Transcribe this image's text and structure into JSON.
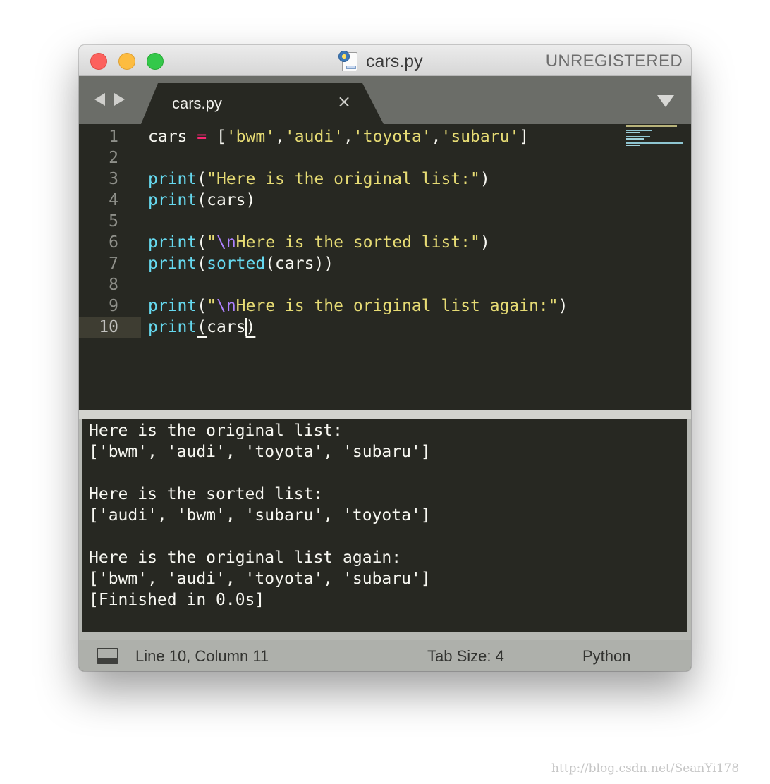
{
  "window": {
    "title": "cars.py",
    "license_label": "UNREGISTERED"
  },
  "icons": {
    "file": "python-file-icon",
    "nav_back": "chevron-left-icon",
    "nav_forward": "chevron-right-icon",
    "tab_close": "close-icon",
    "tab_menu": "dropdown-triangle-icon",
    "panel_toggle": "panel-toggle-icon"
  },
  "tabs": [
    {
      "label": "cars.py",
      "close_symbol": "×",
      "active": true
    }
  ],
  "editor": {
    "active_line": 10,
    "line_numbers": [
      "1",
      "2",
      "3",
      "4",
      "5",
      "6",
      "7",
      "8",
      "9",
      "10"
    ],
    "lines": [
      "cars = ['bwm','audi','toyota','subaru']",
      "",
      "print(\"Here is the original list:\")",
      "print(cars)",
      "",
      "print(\"\\nHere is the sorted list:\")",
      "print(sorted(cars))",
      "",
      "print(\"\\nHere is the original list again:\")",
      "print(cars)"
    ],
    "syntax_colors": {
      "background": "#272822",
      "text": "#f8f8f2",
      "function": "#66d9ef",
      "string": "#e6db74",
      "operator": "#f92672",
      "escape": "#ae81ff",
      "line_number": "#8f908a"
    }
  },
  "output": {
    "lines": [
      "Here is the original list:",
      "['bwm', 'audi', 'toyota', 'subaru']",
      "",
      "Here is the sorted list:",
      "['audi', 'bwm', 'subaru', 'toyota']",
      "",
      "Here is the original list again:",
      "['bwm', 'audi', 'toyota', 'subaru']",
      "[Finished in 0.0s]"
    ]
  },
  "status_bar": {
    "position": "Line 10, Column 11",
    "tab_size": "Tab Size: 4",
    "syntax": "Python"
  },
  "watermark": "http://blog.csdn.net/SeanYi178"
}
